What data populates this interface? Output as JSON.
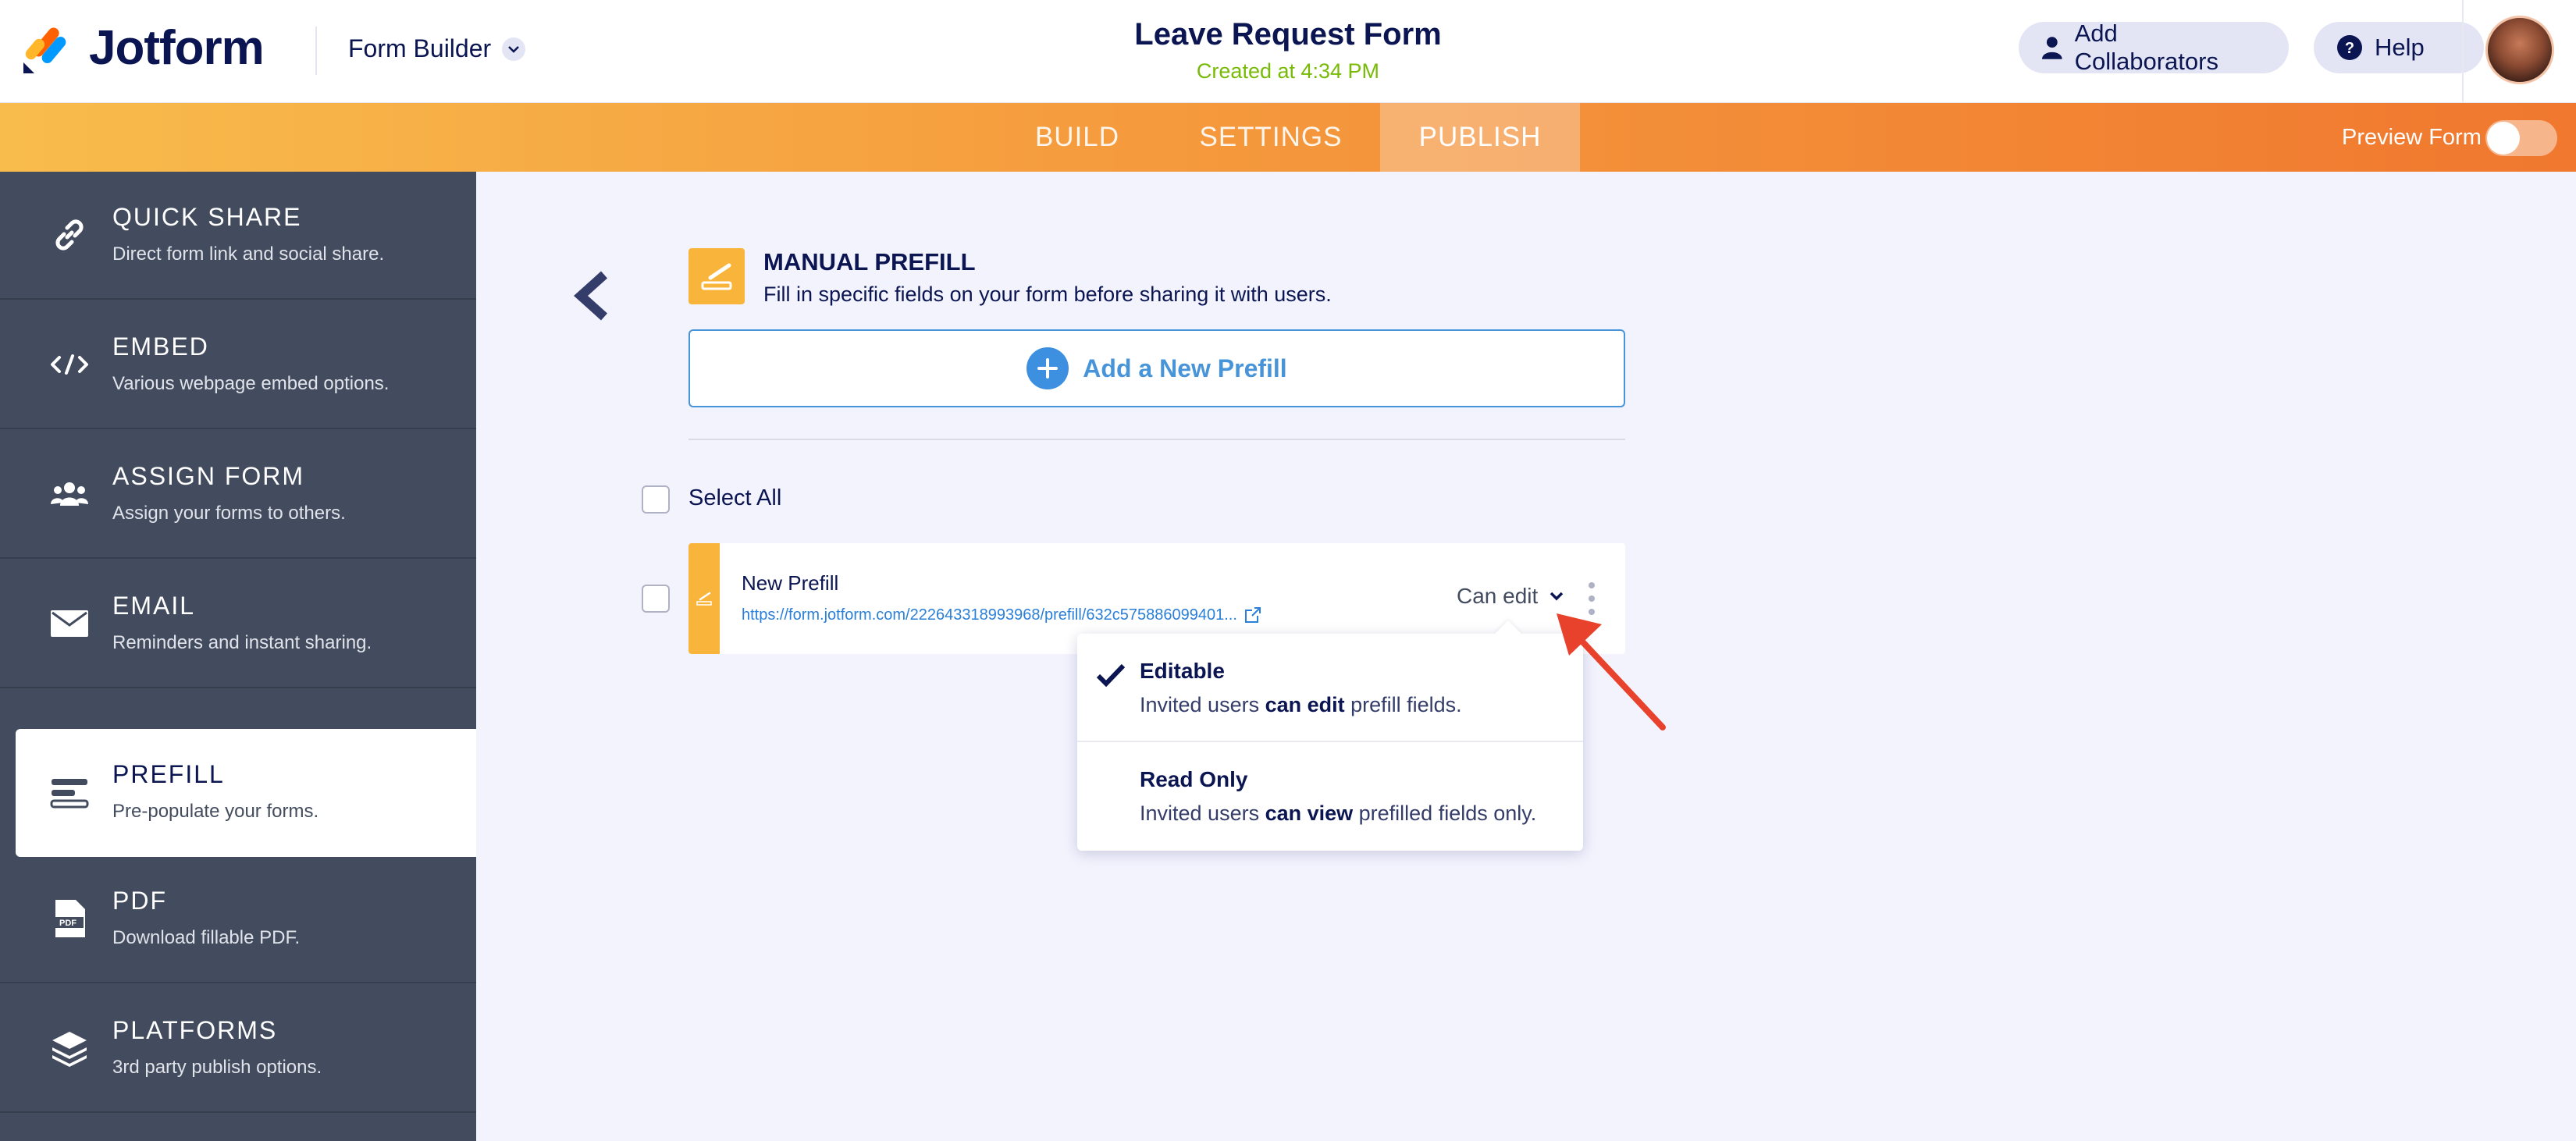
{
  "header": {
    "brand": "Jotform",
    "builder_label": "Form Builder",
    "form_title": "Leave Request Form",
    "created": "Created at 4:34 PM",
    "add_collaborators": "Add Collaborators",
    "help": "Help"
  },
  "nav": {
    "tabs": [
      {
        "label": "BUILD",
        "active": false
      },
      {
        "label": "SETTINGS",
        "active": false
      },
      {
        "label": "PUBLISH",
        "active": true
      }
    ],
    "preview_label": "Preview Form"
  },
  "sidebar": {
    "items": [
      {
        "title": "QUICK SHARE",
        "desc": "Direct form link and social share.",
        "icon": "link-icon"
      },
      {
        "title": "EMBED",
        "desc": "Various webpage embed options.",
        "icon": "code-icon"
      },
      {
        "title": "ASSIGN FORM",
        "desc": "Assign your forms to others.",
        "icon": "users-icon"
      },
      {
        "title": "EMAIL",
        "desc": "Reminders and instant sharing.",
        "icon": "envelope-icon"
      },
      {
        "title": "PREFILL",
        "desc": "Pre-populate your forms.",
        "icon": "prefill-icon",
        "active": true
      },
      {
        "title": "PDF",
        "desc": "Download fillable PDF.",
        "icon": "pdf-icon"
      },
      {
        "title": "PLATFORMS",
        "desc": "3rd party publish options.",
        "icon": "layers-icon"
      }
    ]
  },
  "main": {
    "title": "MANUAL PREFILL",
    "description": "Fill in specific fields on your form before sharing it with users.",
    "add_button": "Add a New Prefill",
    "select_all": "Select All",
    "prefill": {
      "name": "New Prefill",
      "link": "https://form.jotform.com/222643318993968/prefill/632c575886099401...",
      "permission": "Can edit"
    },
    "dropdown": {
      "options": [
        {
          "title": "Editable",
          "pre": "Invited users ",
          "bold": "can edit",
          "post": " prefill fields.",
          "selected": true
        },
        {
          "title": "Read Only",
          "pre": "Invited users ",
          "bold": "can view",
          "post": " prefilled fields only.",
          "selected": false
        }
      ]
    }
  },
  "colors": {
    "accent_orange": "#f59a3d",
    "sidebar_bg": "#434c5e",
    "brand_blue": "#0a1551",
    "link_blue": "#2a7fd8",
    "prefill_yellow": "#f9b53b",
    "annotation_red": "#e8422c"
  }
}
